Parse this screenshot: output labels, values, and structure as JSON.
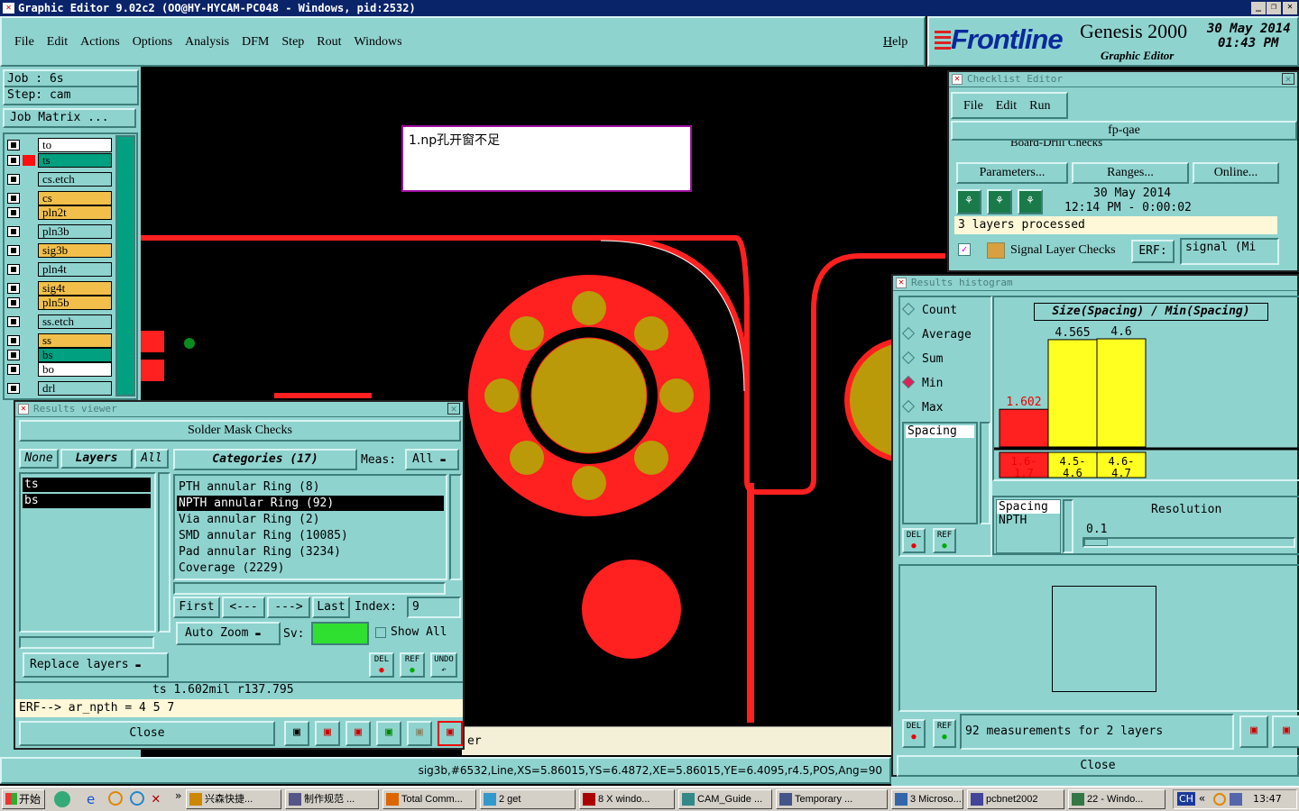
{
  "app_title": "Graphic Editor 9.02c2 (OO@HY-HYCAM-PC048 - Windows, pid:2532)",
  "menu": [
    "File",
    "Edit",
    "Actions",
    "Options",
    "Analysis",
    "DFM",
    "Step",
    "Rout",
    "Windows"
  ],
  "help": "Help",
  "brand": {
    "logo": "Frontline",
    "product": "Genesis 2000",
    "subtitle": "Graphic Editor",
    "date": "30 May 2014",
    "time": "01:43 PM"
  },
  "job": {
    "job_label": "Job : 6s",
    "step_label": "Step: cam",
    "matrix_btn": "Job Matrix ..."
  },
  "layers": [
    {
      "name": "to",
      "color": "#ffffff",
      "sw": ""
    },
    {
      "name": "ts",
      "color": "#00a080",
      "sw": "#ff1010"
    },
    {
      "name": "cs.etch",
      "color": "#8fd3cf",
      "sw": ""
    },
    {
      "name": "cs",
      "color": "#f2c04a",
      "sw": ""
    },
    {
      "name": "pln2t",
      "color": "#f2c04a",
      "sw": ""
    },
    {
      "name": "pln3b",
      "color": "#8fd3cf",
      "sw": ""
    },
    {
      "name": "sig3b",
      "color": "#f2c04a",
      "sw": ""
    },
    {
      "name": "pln4t",
      "color": "#8fd3cf",
      "sw": ""
    },
    {
      "name": "sig4t",
      "color": "#f2c04a",
      "sw": ""
    },
    {
      "name": "pln5b",
      "color": "#f2c04a",
      "sw": ""
    },
    {
      "name": "ss.etch",
      "color": "#8fd3cf",
      "sw": ""
    },
    {
      "name": "ss",
      "color": "#f2c04a",
      "sw": ""
    },
    {
      "name": "bs",
      "color": "#00a080",
      "sw": ""
    },
    {
      "name": "bo",
      "color": "#ffffff",
      "sw": ""
    },
    {
      "name": "drl",
      "color": "#8fd3cf",
      "sw": ""
    }
  ],
  "annotation": "1.np孔开窗不足",
  "results_viewer": {
    "title": "Results viewer",
    "header": "Solder Mask Checks",
    "none": "None",
    "layers": "Layers",
    "all": "All",
    "layer_list": [
      "ts",
      "bs"
    ],
    "categories": "Categories (17)",
    "meas": "Meas:",
    "meas_val": "All",
    "items": [
      "PTH annular Ring (8)",
      "NPTH annular Ring (92)",
      "Via annular Ring (2)",
      "SMD annular Ring (10085)",
      "Pad annular Ring (3234)",
      "Coverage (2229)"
    ],
    "selected": 1,
    "first": "First",
    "prev": "<---",
    "next": "--->",
    "last": "Last",
    "index": "Index:",
    "index_val": "9",
    "auto_zoom": "Auto Zoom",
    "sv": "Sv:",
    "show_all": "Show All",
    "replace": "Replace layers",
    "del": "DEL",
    "ref": "REF",
    "undo": "UNDO",
    "status1": "ts 1.602mil  r137.795",
    "status2": "ERF--> ar_npth = 4 5 7",
    "close": "Close"
  },
  "checklist": {
    "title": "Checklist Editor",
    "menu": [
      "File",
      "Edit",
      "Run"
    ],
    "name": "fp-qae",
    "row0": "Board-Drill Checks",
    "params": "Parameters...",
    "ranges": "Ranges...",
    "online": "Online...",
    "date": "30 May 2014",
    "time": "12:14 PM - 0:00:02",
    "processed": "3 layers processed",
    "row2": "Signal Layer Checks",
    "erf": "ERF:",
    "erf_val": "signal (Mi"
  },
  "histogram": {
    "title": "Results histogram",
    "radios": [
      "Count",
      "Average",
      "Sum",
      "Min",
      "Max"
    ],
    "selected_radio": "Min",
    "attr": "Spacing",
    "chart_title": "Size(Spacing) / Min(Spacing)",
    "resolution_label": "Resolution",
    "resolution_val": "0.1",
    "list": [
      "Spacing",
      "NPTH"
    ],
    "measurements": "92 measurements for 2 layers",
    "close": "Close",
    "del": "DEL",
    "ref": "REF"
  },
  "chart_data": {
    "type": "bar",
    "title": "Size(Spacing) / Min(Spacing)",
    "categories": [
      "1.6-1.7",
      "4.5-4.6",
      "4.6-4.7"
    ],
    "values": [
      1.602,
      4.565,
      4.6
    ],
    "colors": [
      "#ff2020",
      "#ffff20",
      "#ffff20"
    ]
  },
  "status_bar": "sig3b,#6532,Line,XS=5.86015,YS=6.4872,XE=5.86015,YE=6.4095,r4.5,POS,Ang=90",
  "bg_text": "er",
  "taskbar": {
    "start": "开始",
    "items": [
      "兴森快捷...",
      "制作规范 ...",
      "Total Comm...",
      "2 get",
      "8 X windo...",
      "CAM_Guide ...",
      "Temporary ...",
      "3 Microso...",
      "pcbnet2002",
      "22 - Windo..."
    ],
    "lang": "CH",
    "clock": "13:47"
  }
}
